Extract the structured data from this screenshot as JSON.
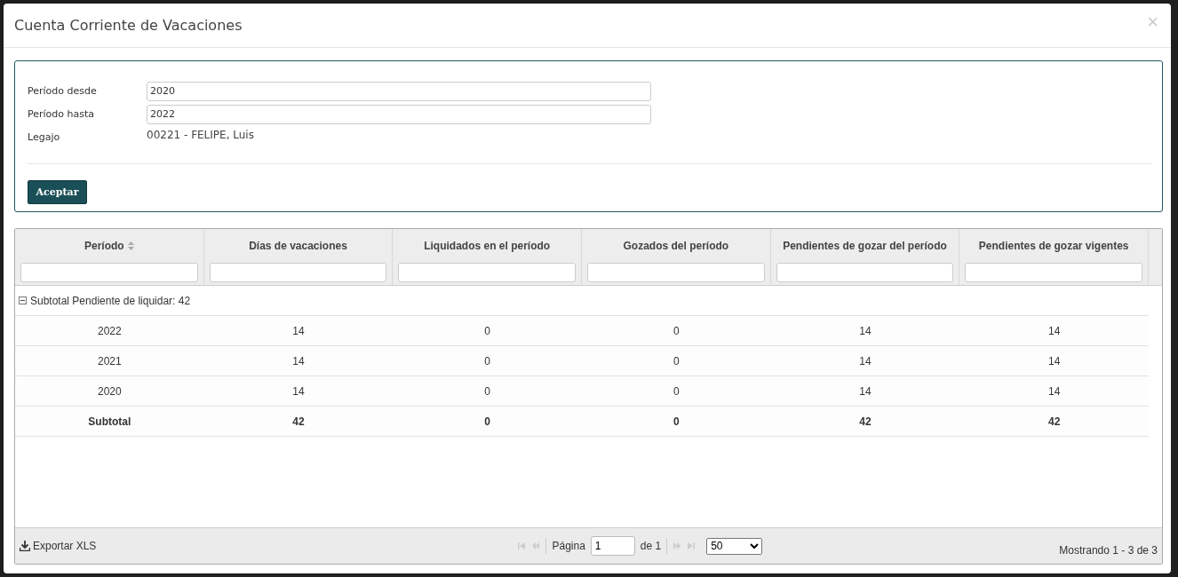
{
  "window": {
    "title": "Cuenta Corriente de Vacaciones",
    "close": "×"
  },
  "form": {
    "fields": [
      {
        "label": "Período desde",
        "kind": "input",
        "value": "2020"
      },
      {
        "label": "Período hasta",
        "kind": "input",
        "value": "2022"
      },
      {
        "label": "Legajo",
        "kind": "text",
        "value": "00221 - FELIPE, Luis"
      }
    ],
    "submit": "Aceptar"
  },
  "table": {
    "columns": [
      {
        "label": "Período",
        "sortable": true
      },
      {
        "label": "Días de vacaciones",
        "sortable": false
      },
      {
        "label": "Liquidados en el período",
        "sortable": false
      },
      {
        "label": "Gozados del período",
        "sortable": false
      },
      {
        "label": "Pendientes de gozar del período",
        "sortable": false
      },
      {
        "label": "Pendientes de gozar vigentes",
        "sortable": false
      }
    ],
    "group": {
      "label": "Subtotal Pendiente de liquidar: 42",
      "expanded": true
    },
    "rows": [
      [
        "2022",
        "14",
        "0",
        "0",
        "14",
        "14"
      ],
      [
        "2021",
        "14",
        "0",
        "0",
        "14",
        "14"
      ],
      [
        "2020",
        "14",
        "0",
        "0",
        "14",
        "14"
      ]
    ],
    "subtotal": [
      "Subtotal",
      "42",
      "0",
      "0",
      "42",
      "42"
    ]
  },
  "footer": {
    "export": "Exportar XLS",
    "page_label": "Página",
    "page": "1",
    "page_of": "de 1",
    "page_size": "50",
    "summary": "Mostrando 1 - 3 de 3"
  }
}
